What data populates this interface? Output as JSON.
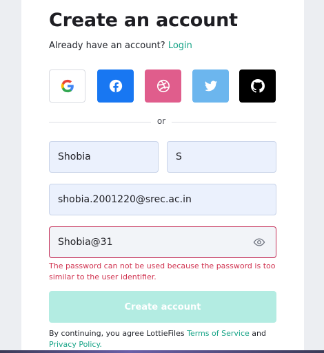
{
  "header": {
    "title": "Create an account",
    "login_prompt": "Already have an account?",
    "login_link": "Login"
  },
  "social": [
    {
      "name": "Google",
      "icon": "google-icon",
      "color": "#ffffff"
    },
    {
      "name": "Facebook",
      "icon": "facebook-icon",
      "color": "#1877f2"
    },
    {
      "name": "Dribbble",
      "icon": "dribbble-icon",
      "color": "#e05d8c"
    },
    {
      "name": "Twitter",
      "icon": "twitter-icon",
      "color": "#6cb6ee"
    },
    {
      "name": "GitHub",
      "icon": "github-icon",
      "color": "#000000"
    }
  ],
  "divider_text": "or",
  "form": {
    "first_name": "Shobia",
    "last_name": "S",
    "email": "shobia.2001220@srec.ac.in",
    "password": "Shobia@31",
    "password_error": "The password can not be used because the password is too similar to the user identifier.",
    "submit_label": "Create account"
  },
  "footer": {
    "terms_prefix": "By continuing, you agree LottieFiles",
    "terms_link": "Terms of Service",
    "and": "and",
    "privacy_link": "Privacy Policy."
  },
  "colors": {
    "accent": "#15a386",
    "error": "#d03350",
    "button_disabled": "#b3ece2"
  }
}
